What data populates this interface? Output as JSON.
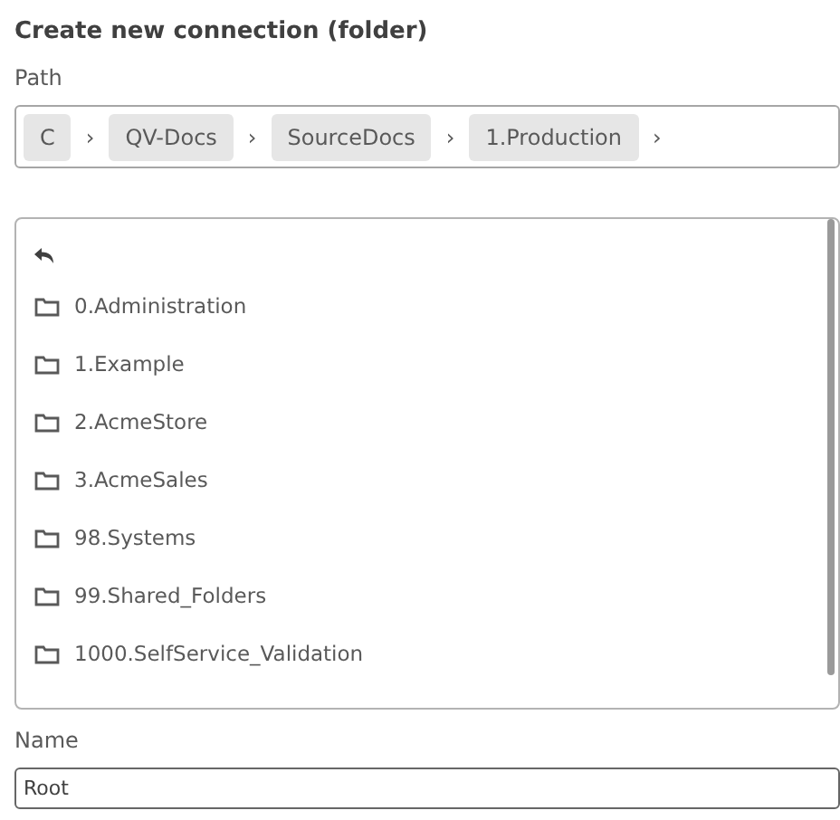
{
  "title": "Create new connection (folder)",
  "path": {
    "label": "Path",
    "crumbs": [
      "C",
      "QV-Docs",
      "SourceDocs",
      "1.Production"
    ],
    "separator": "›"
  },
  "folders": [
    "0.Administration",
    "1.Example",
    "2.AcmeStore",
    "3.AcmeSales",
    "98.Systems",
    "99.Shared_Folders",
    "1000.SelfService_Validation"
  ],
  "name": {
    "label": "Name",
    "value": "Root"
  }
}
